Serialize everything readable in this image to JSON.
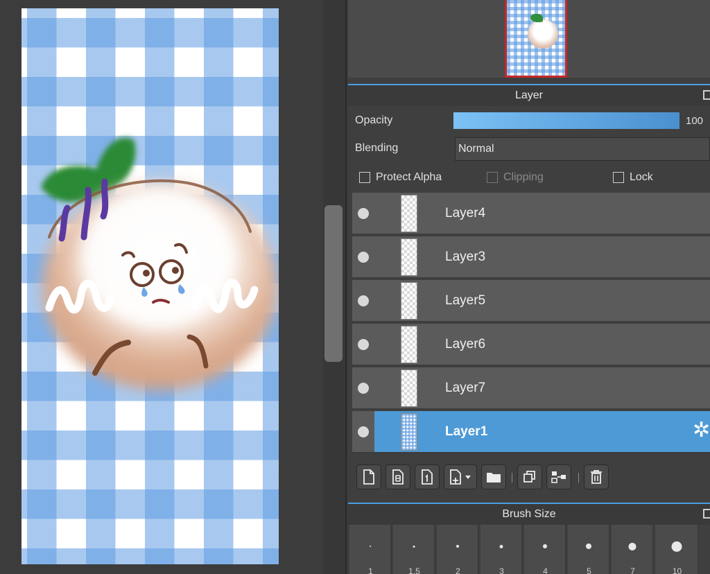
{
  "navigator": {},
  "layer_panel": {
    "title": "Layer",
    "opacity_label": "Opacity",
    "opacity_value": "100",
    "opacity_fraction": 1.0,
    "blending_label": "Blending",
    "blending_value": "Normal",
    "protect_alpha_label": "Protect Alpha",
    "clipping_label": "Clipping",
    "lock_label": "Lock",
    "layers": [
      {
        "name": "Layer4",
        "selected": false
      },
      {
        "name": "Layer3",
        "selected": false
      },
      {
        "name": "Layer5",
        "selected": false
      },
      {
        "name": "Layer6",
        "selected": false
      },
      {
        "name": "Layer7",
        "selected": false
      },
      {
        "name": "Layer1",
        "selected": true
      }
    ]
  },
  "brush_panel": {
    "title": "Brush Size",
    "sizes": [
      "1",
      "1.5",
      "2",
      "3",
      "4",
      "5",
      "7",
      "10"
    ]
  },
  "colors": {
    "accent": "#4d9ad6",
    "nav_frame": "#c82828"
  },
  "icons": [
    "new-layer-icon",
    "new-8bit-layer-icon",
    "new-1bit-layer-icon",
    "add-layer-dropdown-icon",
    "folder-icon",
    "duplicate-layer-icon",
    "merge-layer-icon",
    "trash-icon",
    "gear-icon"
  ]
}
